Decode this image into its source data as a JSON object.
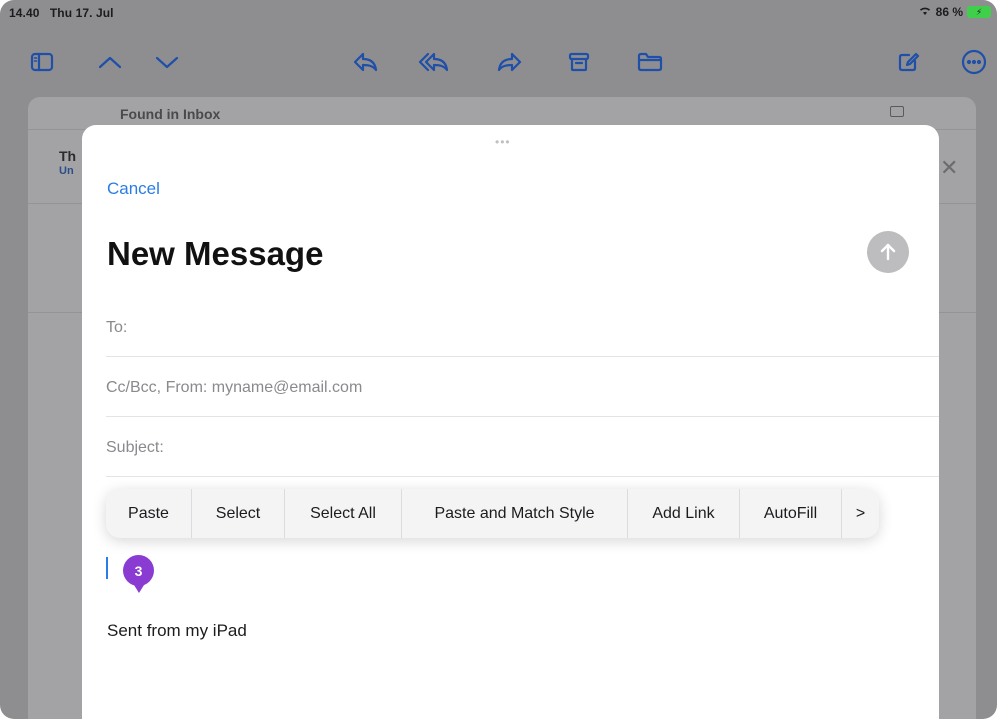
{
  "status": {
    "time": "14.40",
    "date": "Thu 17. Jul",
    "battery": "86 %"
  },
  "toolbar": {
    "icons": [
      "sidebar-icon",
      "chevron-up-icon",
      "chevron-down-icon",
      "reply-icon",
      "reply-all-icon",
      "forward-icon",
      "archive-icon",
      "folder-icon",
      "compose-icon",
      "more-icon"
    ]
  },
  "mail": {
    "found_label": "Found in Inbox",
    "row_title": "Th",
    "row_sub": "Un"
  },
  "compose": {
    "cancel_label": "Cancel",
    "title": "New Message",
    "to_label": "To:",
    "cc_label": "Cc/Bcc, From: myname@email.com",
    "subject_label": "Subject:",
    "signature": "Sent from my iPad",
    "badge": "3"
  },
  "edit_menu": {
    "items": [
      "Paste",
      "Select",
      "Select All",
      "Paste and Match Style",
      "Add Link",
      "AutoFill",
      ">"
    ]
  },
  "colors": {
    "accent": "#2b7de3",
    "badge": "#8a3bd1",
    "toolbar_icon": "#1f4fa8"
  }
}
